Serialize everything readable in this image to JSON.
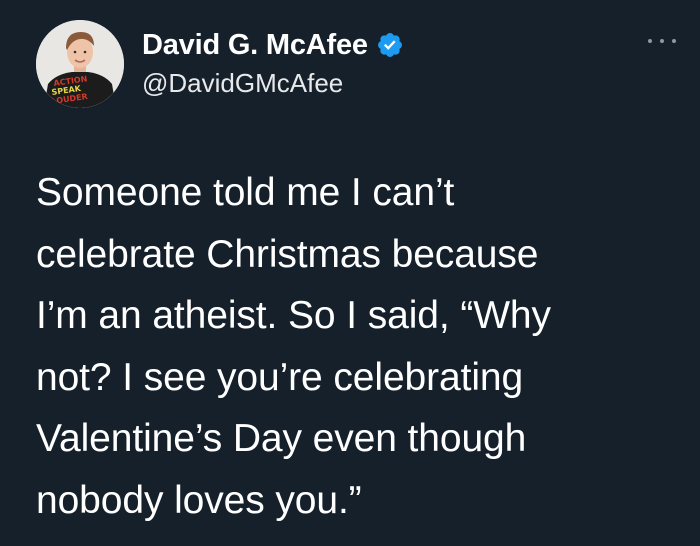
{
  "author": {
    "display_name": "David G. McAfee",
    "handle": "@DavidGMcAfee",
    "verified": true,
    "avatar_shirt_text": "ACTIONS SPEAK LOUDER"
  },
  "tweet": {
    "lines": [
      "Someone told me I can’t",
      "celebrate Christmas because",
      "I’m an atheist. So I said, “Why",
      "not? I see you’re celebrating",
      "Valentine’s Day even though",
      "nobody loves you.”"
    ]
  },
  "icons": {
    "verified": "verified-badge-icon",
    "more": "more-options-icon"
  },
  "colors": {
    "background": "#15202b",
    "text": "#ffffff",
    "verified_blue": "#1d9bf0",
    "muted": "#8b98a5"
  }
}
